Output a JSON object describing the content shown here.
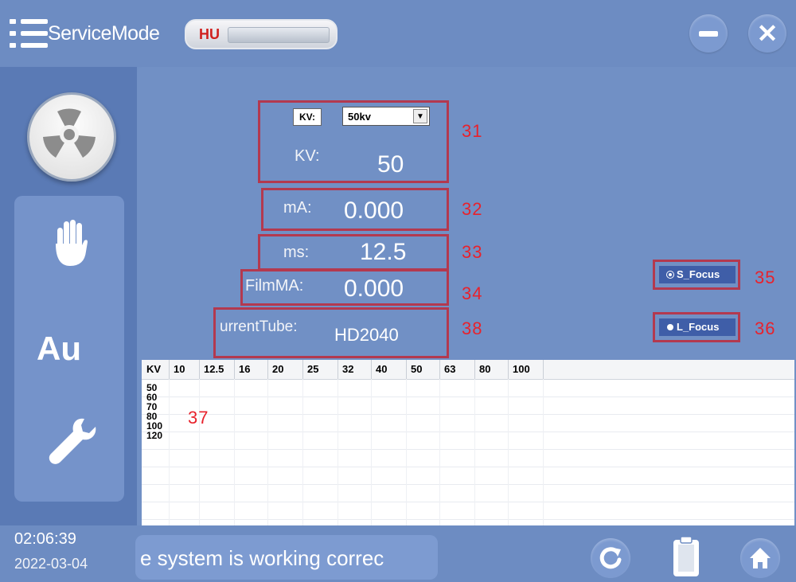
{
  "header": {
    "title": "ServiceMode",
    "hu_label": "HU"
  },
  "sidebar": {
    "au_label": "Au"
  },
  "form": {
    "kv_select_label": "KV:",
    "kv_select_value": "50kv",
    "kv_label": "KV:",
    "kv_value": "50",
    "ma_label": "mA:",
    "ma_value": "0.000",
    "ms_label": "ms:",
    "ms_value": "12.5",
    "film_ma_label": "FilmMA:",
    "film_ma_value": "0.000",
    "current_tube_label": "urrentTube:",
    "current_tube_value": "HD2040"
  },
  "focus": {
    "s_focus": "S_Focus",
    "l_focus": "L_Focus"
  },
  "annotations": {
    "a31": "31",
    "a32": "32",
    "a33": "33",
    "a34": "34",
    "a35": "35",
    "a36": "36",
    "a37": "37",
    "a38": "38"
  },
  "table": {
    "headers": [
      "KV",
      "10",
      "12.5",
      "16",
      "20",
      "25",
      "32",
      "40",
      "50",
      "63",
      "80",
      "100"
    ],
    "rows": [
      "50",
      "60",
      "70",
      "80",
      "100",
      "120"
    ]
  },
  "footer": {
    "time": "02:06:39",
    "date": "2022-03-04",
    "status": "e system is working correc"
  },
  "colors": {
    "annotation_red": "#e8222c",
    "box_border": "#b3394f",
    "background_blue": "#6f8fc4"
  }
}
